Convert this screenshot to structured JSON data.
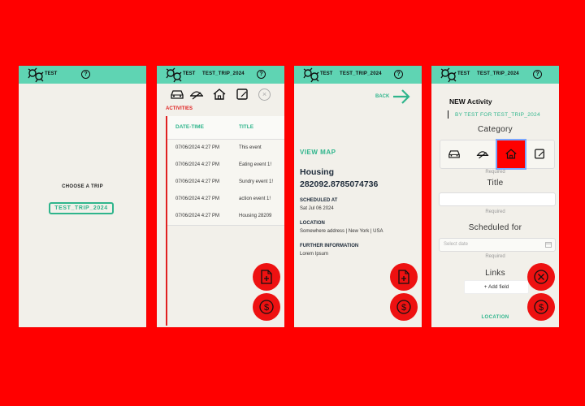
{
  "app": {
    "logo_text": "TEST",
    "help_icon": "?"
  },
  "screen1": {
    "choose_label": "CHOOSE A TRIP",
    "trip_button": "TEST_TRIP_2024"
  },
  "screen2": {
    "trip_title": "TEST_TRIP_2024",
    "activities_label": "ACTIVITIES",
    "columns": [
      "DATE-TIME",
      "TITLE"
    ],
    "rows": [
      {
        "date": "07/06/2024 4:27 PM",
        "title": "This event"
      },
      {
        "date": "07/06/2024 4:27 PM",
        "title": "Eating event 1!"
      },
      {
        "date": "07/06/2024 4:27 PM",
        "title": "Sundry event 1!"
      },
      {
        "date": "07/06/2024 4:27 PM",
        "title": "action event 1!"
      },
      {
        "date": "07/06/2024 4:27 PM",
        "title": "Housing 28209"
      }
    ]
  },
  "screen3": {
    "trip_title": "TEST_TRIP_2024",
    "back_label": "BACK",
    "view_map": "VIEW MAP",
    "activity_type": "Housing",
    "activity_id": "282092.8785074736",
    "scheduled_label": "SCHEDULED AT",
    "scheduled_value": "Sat Jul 06 2024",
    "location_label": "LOCATION",
    "location_value": "Somewhere address | New York | USA",
    "further_label": "FURTHER INFORMATION",
    "further_value": "Lorem Ipsum"
  },
  "screen4": {
    "trip_title": "TEST_TRIP_2024",
    "new_activity": "NEW Activity",
    "by_test": "BY TEST FOR TEST_TRIP_2024",
    "category_label": "Category",
    "required": "Required",
    "title_label": "Title",
    "scheduled_label": "Scheduled for",
    "date_placeholder": "Select date",
    "links_label": "Links",
    "add_field": "Add field",
    "location_label": "LOCATION"
  },
  "colors": {
    "background": "#ff0000",
    "header": "#5fd4b3",
    "accent": "#2fb58c",
    "fab": "#ee1111"
  },
  "icons": [
    "logo-icon",
    "help-icon",
    "car-icon",
    "food-icon",
    "home-icon",
    "note-icon",
    "close-icon",
    "add-document-icon",
    "dollar-icon",
    "arrow-right-icon",
    "calendar-icon",
    "plus-icon"
  ]
}
